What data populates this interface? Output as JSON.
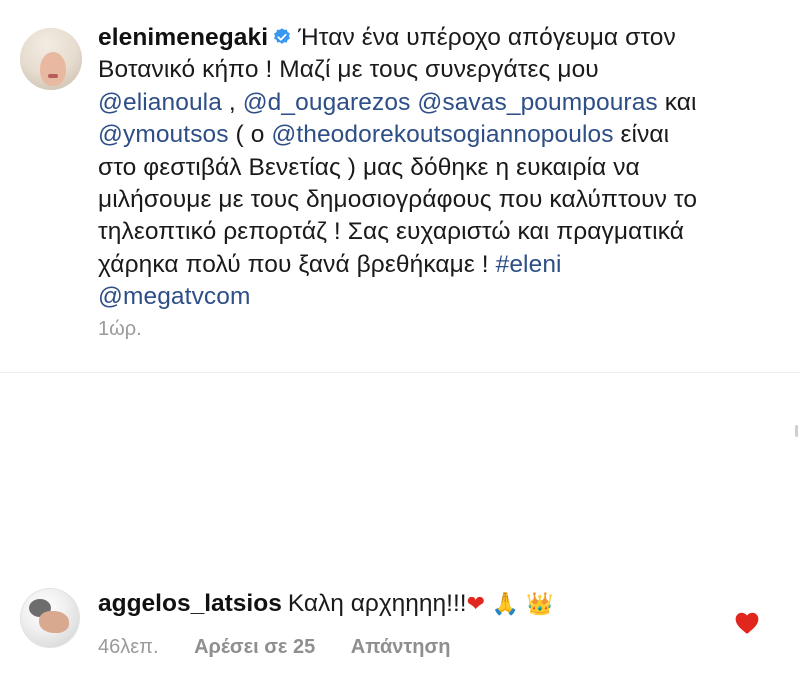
{
  "post": {
    "username": "elenimenegaki",
    "caption_line1": "Ήταν ένα υπέροχο απόγευμα στον",
    "caption_line2": "Βοτανικό κήπο ! Μαζί με τους συνεργάτες μου",
    "mention_1": "@elianoula",
    "sep_1": " , ",
    "mention_2": "@d_ougarezos",
    "sep_2": " ",
    "mention_3": "@savas_poumpouras",
    "word_kai": " και",
    "mention_4": "@ymoutsos",
    "paren_open": " ( ο ",
    "mention_5": "@theodorekoutsogiannopoulos",
    "text_einai": " είναι",
    "caption_line5": "στο φεστιβάλ Βενετίας ) μας δόθηκε η ευκαιρία να",
    "caption_line6": "μιλήσουμε  με τους δημοσιογράφους που καλύπτουν το",
    "caption_line7": "τηλεοπτικό ρεπορτάζ ! Σας ευχαριστώ και πραγματικά",
    "caption_line8_text": "χάρηκα πολύ που ξανά βρεθήκαμε ! ",
    "hashtag": "#eleni",
    "mention_6": "@megatvcom",
    "time": "1ώρ.",
    "verified_icon": "verified-badge-icon",
    "accent_color": "#2d4e86"
  },
  "comment": {
    "username": "aggelos_latsios",
    "text": "Καλη αρχηηηη!!!",
    "emoji_heart": "❤",
    "emoji_pray": "🙏",
    "emoji_crown": "👑",
    "time": "46λεπ.",
    "likes": "Αρέσει σε 25",
    "reply": "Απάντηση",
    "like_icon": "heart-icon",
    "like_color": "#e0261d"
  }
}
